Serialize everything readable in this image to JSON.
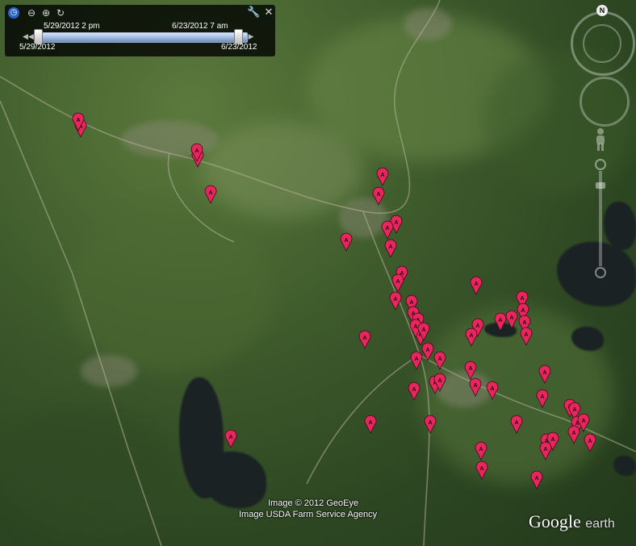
{
  "timeline": {
    "current_start": "5/29/2012  2 pm",
    "current_end": "6/23/2012  7 am",
    "range_start": "5/29/2012",
    "range_end": "6/23/2012"
  },
  "compass": {
    "north_label": "N"
  },
  "attribution": {
    "line1": "Image © 2012 GeoEye",
    "line2": "Image USDA Farm Service Agency"
  },
  "logo": {
    "word1": "Google",
    "word2": "earth"
  },
  "placemark": {
    "letter": "A",
    "color": "#e8265e"
  },
  "colors": {
    "placemark_fill": "#e8265e",
    "timeline_bg": "#000000",
    "track": "#6c8ec2"
  }
}
